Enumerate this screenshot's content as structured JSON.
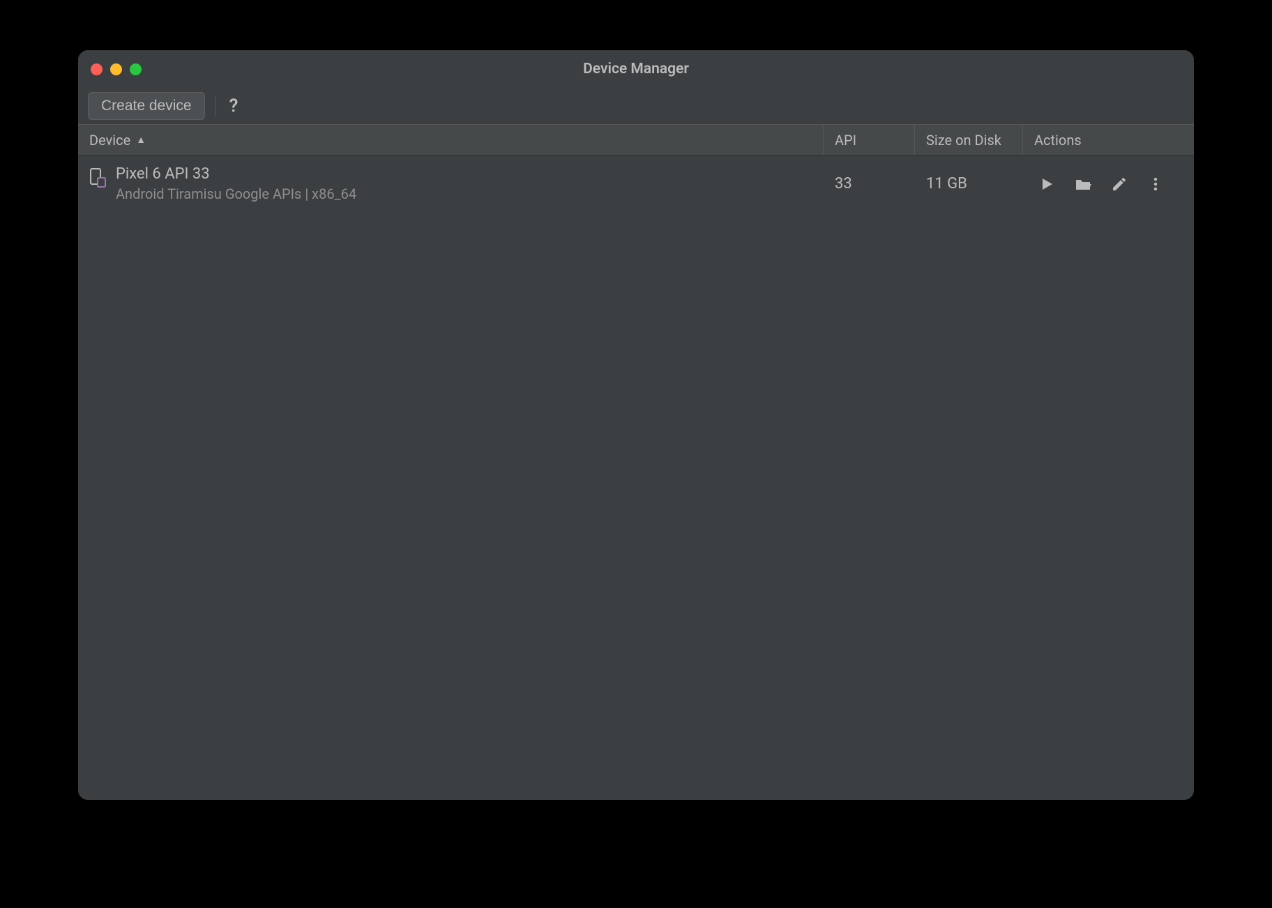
{
  "window": {
    "title": "Device Manager"
  },
  "toolbar": {
    "create_label": "Create device"
  },
  "table": {
    "headers": {
      "device": "Device",
      "api": "API",
      "size": "Size on Disk",
      "actions": "Actions"
    },
    "rows": [
      {
        "name": "Pixel 6 API 33",
        "subtitle": "Android Tiramisu Google APIs | x86_64",
        "api": "33",
        "size": "11 GB"
      }
    ]
  }
}
